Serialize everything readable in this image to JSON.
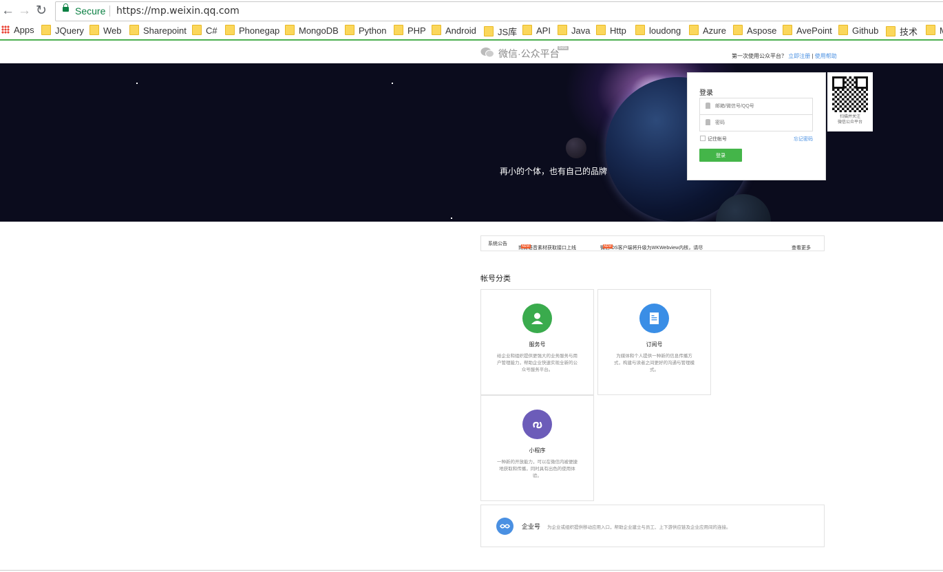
{
  "browser": {
    "secure_label": "Secure",
    "url": "https://mp.weixin.qq.com",
    "bookmarks": [
      "Apps",
      "JQuery",
      "Web",
      "Sharepoint",
      "C#",
      "Phonegap",
      "MongoDB",
      "Python",
      "PHP",
      "Android",
      "JS库",
      "API",
      "Java",
      "Http",
      "loudong",
      "Azure",
      "Aspose",
      "AvePoint",
      "Github",
      "技术",
      "M"
    ]
  },
  "header": {
    "logo_text": "微信·公众平台",
    "logo_tag": "beta",
    "first_time": "第一次使用公众平台？",
    "register": "立即注册",
    "help": "使用帮助"
  },
  "banner": {
    "slogan": "再小的个体，也有自己的品牌"
  },
  "login": {
    "title": "登录",
    "account_placeholder": "邮箱/微信号/QQ号",
    "password_placeholder": "密码",
    "remember": "记住帐号",
    "forgot": "忘记密码",
    "submit": "登录"
  },
  "qr": {
    "line1": "扫描并关注",
    "line2": "微信公众平台"
  },
  "notice": {
    "label": "系统公告",
    "item1": "尚清语音素材获取接口上线",
    "item2": "微信iOS客户端将升级为WKWebview内核，请尽",
    "new_tag": "NEW",
    "more": "查看更多"
  },
  "accounts": {
    "title": "帐号分类",
    "service": {
      "title": "服务号",
      "desc": "给企业和组织提供更强大的业务服务与用户管理能力，帮助企业快速实现全新的公众号服务平台。"
    },
    "subscription": {
      "title": "订阅号",
      "desc": "为媒体和个人提供一种新的信息传播方式，构建与读者之间更好的沟通与管理模式。"
    },
    "miniprogram": {
      "title": "小程序",
      "desc": "一种新的开放能力，可以在微信内被便捷地获取和传播，同时具有出色的使用体验。"
    },
    "enterprise": {
      "title": "企业号",
      "desc": "为企业或组织提供移动应用入口，帮助企业建立与员工、上下游供应链及企业应用间的连接。"
    }
  },
  "colors": {
    "service": "#3aab4d",
    "subscription": "#3a8ee6",
    "miniprogram": "#6c5cb9",
    "enterprise": "#4a90e2",
    "login_button": "#44b549"
  }
}
